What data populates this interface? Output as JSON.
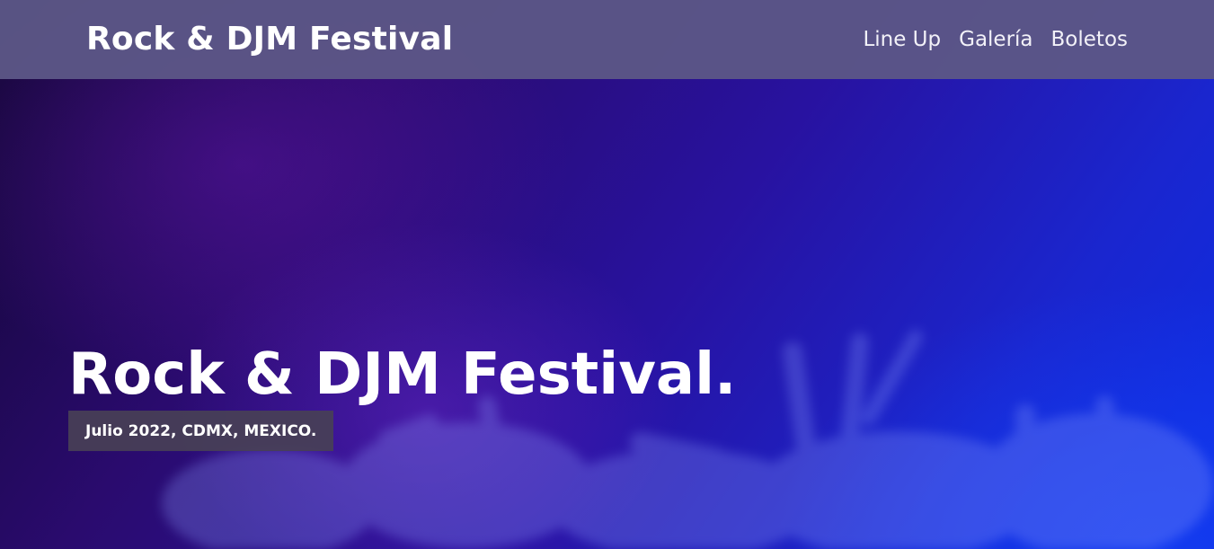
{
  "navbar": {
    "brand": "Rock & DJM Festival",
    "links": [
      {
        "label": "Line Up"
      },
      {
        "label": "Galería"
      },
      {
        "label": "Boletos"
      }
    ]
  },
  "hero": {
    "title": "Rock & DJM Festival.",
    "tagline": "Julio 2022, CDMX, MEXICO."
  },
  "colors": {
    "navbar_bg": "#5c5686",
    "hero_gradient_start": "#120632",
    "hero_gradient_end": "#0b2ee6",
    "tag_bg": "#484056",
    "text": "#ffffff"
  }
}
